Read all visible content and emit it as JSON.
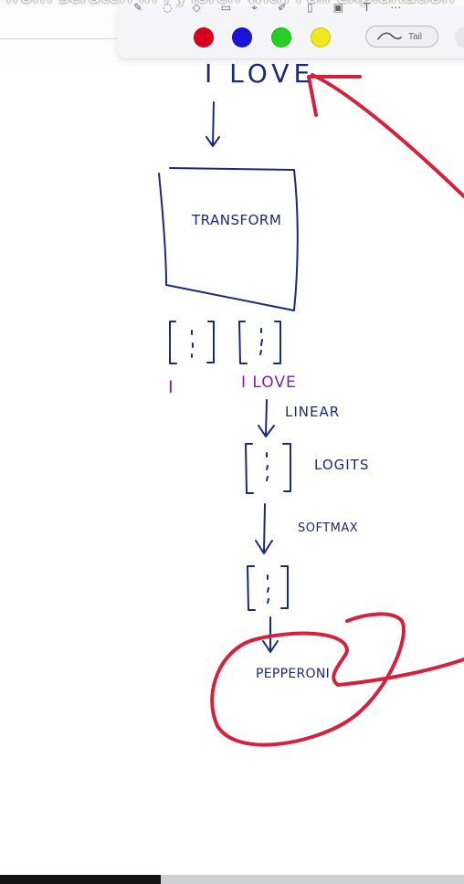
{
  "video": {
    "title": "from scratch in PyTorch with Full explanation"
  },
  "toolbar": {
    "colors": [
      {
        "name": "red",
        "hex": "#d8001c"
      },
      {
        "name": "blue",
        "hex": "#1a14d6"
      },
      {
        "name": "green",
        "hex": "#27cf22"
      },
      {
        "name": "yellow",
        "hex": "#f0e81e"
      }
    ],
    "tail_label": "Tail",
    "top_icons": [
      "pen-icon",
      "lasso-icon",
      "shape-icon",
      "eraser-icon",
      "select-icon",
      "marker-icon",
      "ruler-icon",
      "image-icon",
      "text-icon",
      "more-icon"
    ]
  },
  "sketch": {
    "input_text": "I LOVE",
    "block_label": "TRANSFORM",
    "output_token_1": "I",
    "output_token_2": "I LOVE",
    "step_linear": "LINEAR",
    "step_logits": "LOGITS",
    "step_softmax": "SOFTMAX",
    "prediction": "PEPPERONI",
    "ink_blue": "#1b2a78",
    "ink_purple": "#8a1aa8",
    "ink_red": "#d4213d"
  }
}
